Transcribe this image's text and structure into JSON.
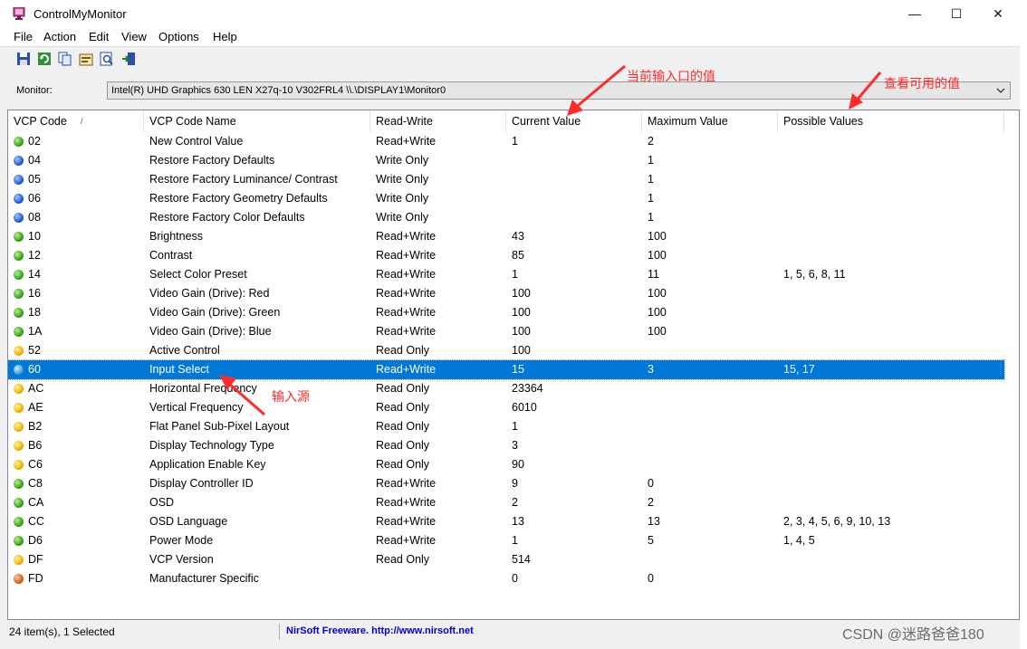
{
  "window": {
    "title": "ControlMyMonitor",
    "controls": {
      "minimize": "—",
      "maximize": "☐",
      "close": "✕"
    }
  },
  "menu": [
    "File",
    "Action",
    "Edit",
    "View",
    "Options",
    "Help"
  ],
  "toolbar": {
    "icons": [
      "save-icon",
      "refresh-icon",
      "copy-icon",
      "properties-icon",
      "find-icon",
      "exit-icon"
    ]
  },
  "monitor": {
    "label": "Monitor:",
    "selected": "Intel(R) UHD Graphics 630  LEN X27q-10  V302FRL4  \\\\.\\DISPLAY1\\Monitor0"
  },
  "columns": [
    "VCP Code",
    "VCP Code Name",
    "Read-Write",
    "Current Value",
    "Maximum Value",
    "Possible Values"
  ],
  "sort_indicator": "/",
  "rows": [
    {
      "code": "02",
      "name": "New Control Value",
      "rw": "Read+Write",
      "current": "1",
      "max": "2",
      "possible": "",
      "dot": "green"
    },
    {
      "code": "04",
      "name": "Restore Factory Defaults",
      "rw": "Write Only",
      "current": "",
      "max": "1",
      "possible": "",
      "dot": "blue"
    },
    {
      "code": "05",
      "name": "Restore Factory Luminance/ Contrast",
      "rw": "Write Only",
      "current": "",
      "max": "1",
      "possible": "",
      "dot": "blue"
    },
    {
      "code": "06",
      "name": "Restore Factory Geometry Defaults",
      "rw": "Write Only",
      "current": "",
      "max": "1",
      "possible": "",
      "dot": "blue"
    },
    {
      "code": "08",
      "name": "Restore Factory Color Defaults",
      "rw": "Write Only",
      "current": "",
      "max": "1",
      "possible": "",
      "dot": "blue"
    },
    {
      "code": "10",
      "name": "Brightness",
      "rw": "Read+Write",
      "current": "43",
      "max": "100",
      "possible": "",
      "dot": "green"
    },
    {
      "code": "12",
      "name": "Contrast",
      "rw": "Read+Write",
      "current": "85",
      "max": "100",
      "possible": "",
      "dot": "green"
    },
    {
      "code": "14",
      "name": "Select Color Preset",
      "rw": "Read+Write",
      "current": "1",
      "max": "11",
      "possible": "1, 5, 6, 8, 11",
      "dot": "green"
    },
    {
      "code": "16",
      "name": "Video Gain (Drive): Red",
      "rw": "Read+Write",
      "current": "100",
      "max": "100",
      "possible": "",
      "dot": "green"
    },
    {
      "code": "18",
      "name": "Video Gain (Drive): Green",
      "rw": "Read+Write",
      "current": "100",
      "max": "100",
      "possible": "",
      "dot": "green"
    },
    {
      "code": "1A",
      "name": "Video Gain (Drive): Blue",
      "rw": "Read+Write",
      "current": "100",
      "max": "100",
      "possible": "",
      "dot": "green"
    },
    {
      "code": "52",
      "name": "Active Control",
      "rw": "Read Only",
      "current": "100",
      "max": "",
      "possible": "",
      "dot": "yellow"
    },
    {
      "code": "60",
      "name": "Input Select",
      "rw": "Read+Write",
      "current": "15",
      "max": "3",
      "possible": "15, 17",
      "dot": "selected",
      "selected": true
    },
    {
      "code": "AC",
      "name": "Horizontal Frequency",
      "rw": "Read Only",
      "current": "23364",
      "max": "",
      "possible": "",
      "dot": "yellow"
    },
    {
      "code": "AE",
      "name": "Vertical Frequency",
      "rw": "Read Only",
      "current": "6010",
      "max": "",
      "possible": "",
      "dot": "yellow"
    },
    {
      "code": "B2",
      "name": "Flat Panel Sub-Pixel Layout",
      "rw": "Read Only",
      "current": "1",
      "max": "",
      "possible": "",
      "dot": "yellow"
    },
    {
      "code": "B6",
      "name": "Display Technology Type",
      "rw": "Read Only",
      "current": "3",
      "max": "",
      "possible": "",
      "dot": "yellow"
    },
    {
      "code": "C6",
      "name": "Application Enable Key",
      "rw": "Read Only",
      "current": "90",
      "max": "",
      "possible": "",
      "dot": "yellow"
    },
    {
      "code": "C8",
      "name": "Display Controller ID",
      "rw": "Read+Write",
      "current": "9",
      "max": "0",
      "possible": "",
      "dot": "green"
    },
    {
      "code": "CA",
      "name": "OSD",
      "rw": "Read+Write",
      "current": "2",
      "max": "2",
      "possible": "",
      "dot": "green"
    },
    {
      "code": "CC",
      "name": "OSD Language",
      "rw": "Read+Write",
      "current": "13",
      "max": "13",
      "possible": "2, 3, 4, 5, 6, 9, 10, 13",
      "dot": "green"
    },
    {
      "code": "D6",
      "name": "Power Mode",
      "rw": "Read+Write",
      "current": "1",
      "max": "5",
      "possible": "1, 4, 5",
      "dot": "green"
    },
    {
      "code": "DF",
      "name": "VCP Version",
      "rw": "Read Only",
      "current": "514",
      "max": "",
      "possible": "",
      "dot": "yellow"
    },
    {
      "code": "FD",
      "name": "Manufacturer Specific",
      "rw": "",
      "current": "0",
      "max": "0",
      "possible": "",
      "dot": "brown"
    }
  ],
  "status": {
    "left": "24 item(s), 1 Selected",
    "link": "NirSoft Freeware.  http://www.nirsoft.net"
  },
  "annotations": {
    "current_value": "当前输入口的值",
    "possible_values": "查看可用的值",
    "input_source": "输入源",
    "color": "#ff2a2a"
  },
  "watermark": "CSDN @迷路爸爸180"
}
